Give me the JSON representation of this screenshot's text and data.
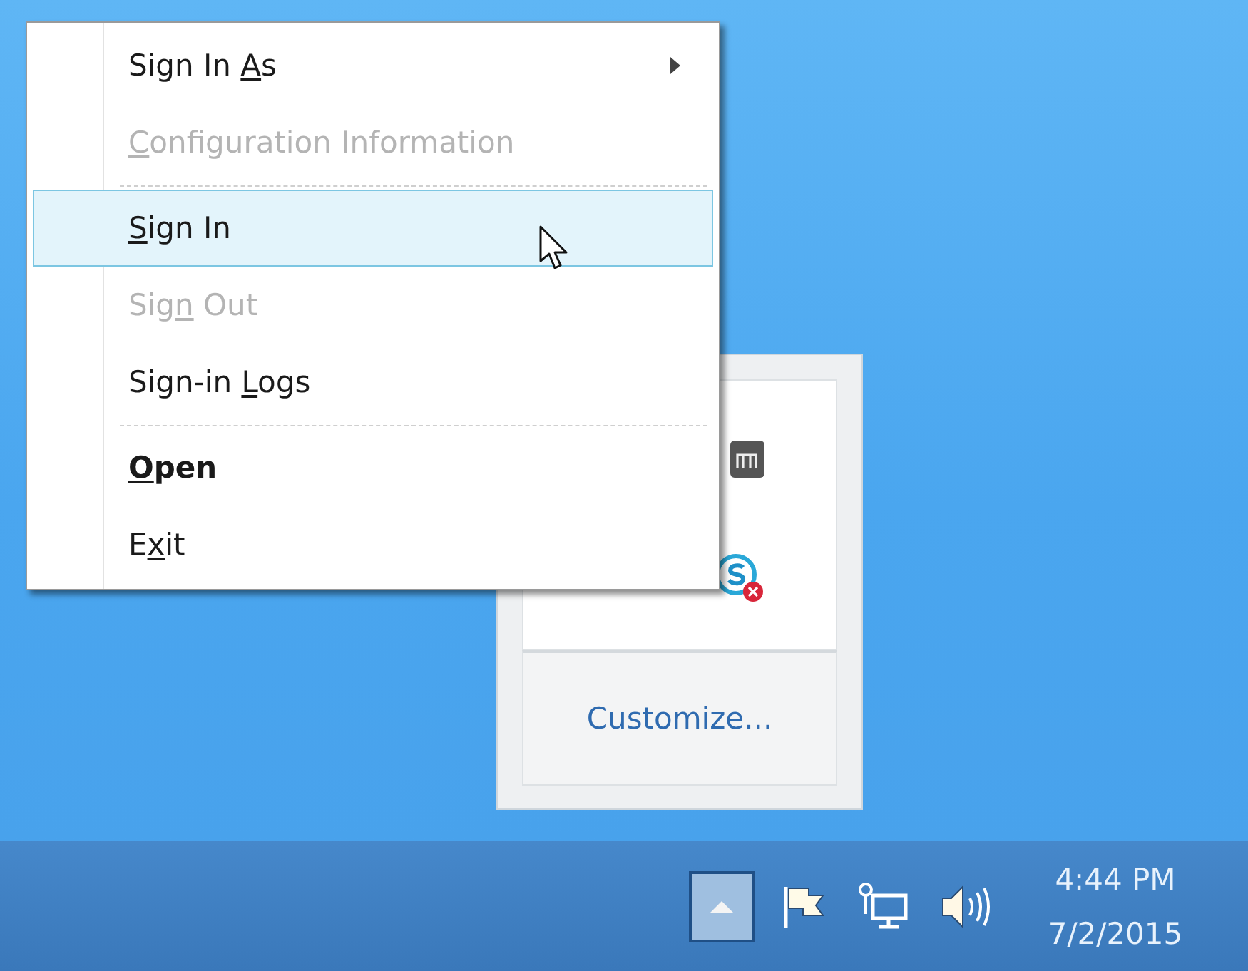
{
  "menu": {
    "items": [
      {
        "kind": "item",
        "label": {
          "pre": "Sign In ",
          "key": "A",
          "post": "s"
        },
        "disabled": false,
        "selected": false,
        "bold": false,
        "submenu": true
      },
      {
        "kind": "item",
        "label": {
          "key": "C",
          "post": "onfiguration Information"
        },
        "disabled": true,
        "selected": false,
        "bold": false,
        "submenu": false
      },
      {
        "kind": "separator"
      },
      {
        "kind": "item",
        "label": {
          "key": "S",
          "post": "ign In"
        },
        "disabled": false,
        "selected": true,
        "bold": false,
        "submenu": false
      },
      {
        "kind": "item",
        "label": {
          "pre": "Sig",
          "key": "n",
          "post": " Out"
        },
        "disabled": true,
        "selected": false,
        "bold": false,
        "submenu": false
      },
      {
        "kind": "item",
        "label": {
          "pre": "Sign-in ",
          "key": "L",
          "post": "ogs"
        },
        "disabled": false,
        "selected": false,
        "bold": false,
        "submenu": false
      },
      {
        "kind": "separator"
      },
      {
        "kind": "item",
        "label": {
          "key": "O",
          "post": "pen"
        },
        "disabled": false,
        "selected": false,
        "bold": true,
        "submenu": false
      },
      {
        "kind": "item",
        "label": {
          "pre": "E",
          "key": "x",
          "post": "it"
        },
        "disabled": false,
        "selected": false,
        "bold": false,
        "submenu": false
      }
    ]
  },
  "tray_overflow": {
    "link": "Customize..."
  },
  "taskbar": {
    "show_hidden_button": {
      "selected": true
    },
    "time": "4:44 PM",
    "date": "7/2/2015"
  }
}
